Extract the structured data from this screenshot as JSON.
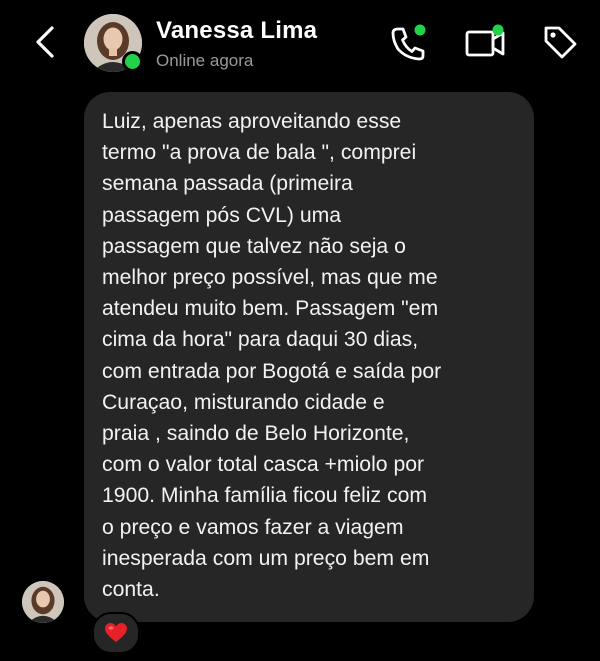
{
  "header": {
    "contact_name": "Vanessa Lima",
    "status": "Online agora",
    "online_color": "#22d34a",
    "icons": [
      "back-icon",
      "phone-icon",
      "video-icon",
      "tag-icon"
    ]
  },
  "message": {
    "text": "Luiz, apenas aproveitando esse\ntermo \"a prova de bala \", comprei\nsemana passada (primeira\npassagem pós CVL)  uma\npassagem que talvez não seja o\nmelhor preço possível, mas que me\natendeu muito bem. Passagem \"em\ncima da hora\" para daqui 30 dias,\ncom entrada por Bogotá e saída por\nCuraçao, misturando cidade e\npraia ,  saindo de Belo Horizonte,\ncom o valor total casca +miolo por\n1900. Minha família ficou feliz com\no preço e vamos fazer a viagem\ninesperada com um preço bem em\nconta.",
    "bubble_color": "#262626",
    "reaction": "❤️"
  }
}
